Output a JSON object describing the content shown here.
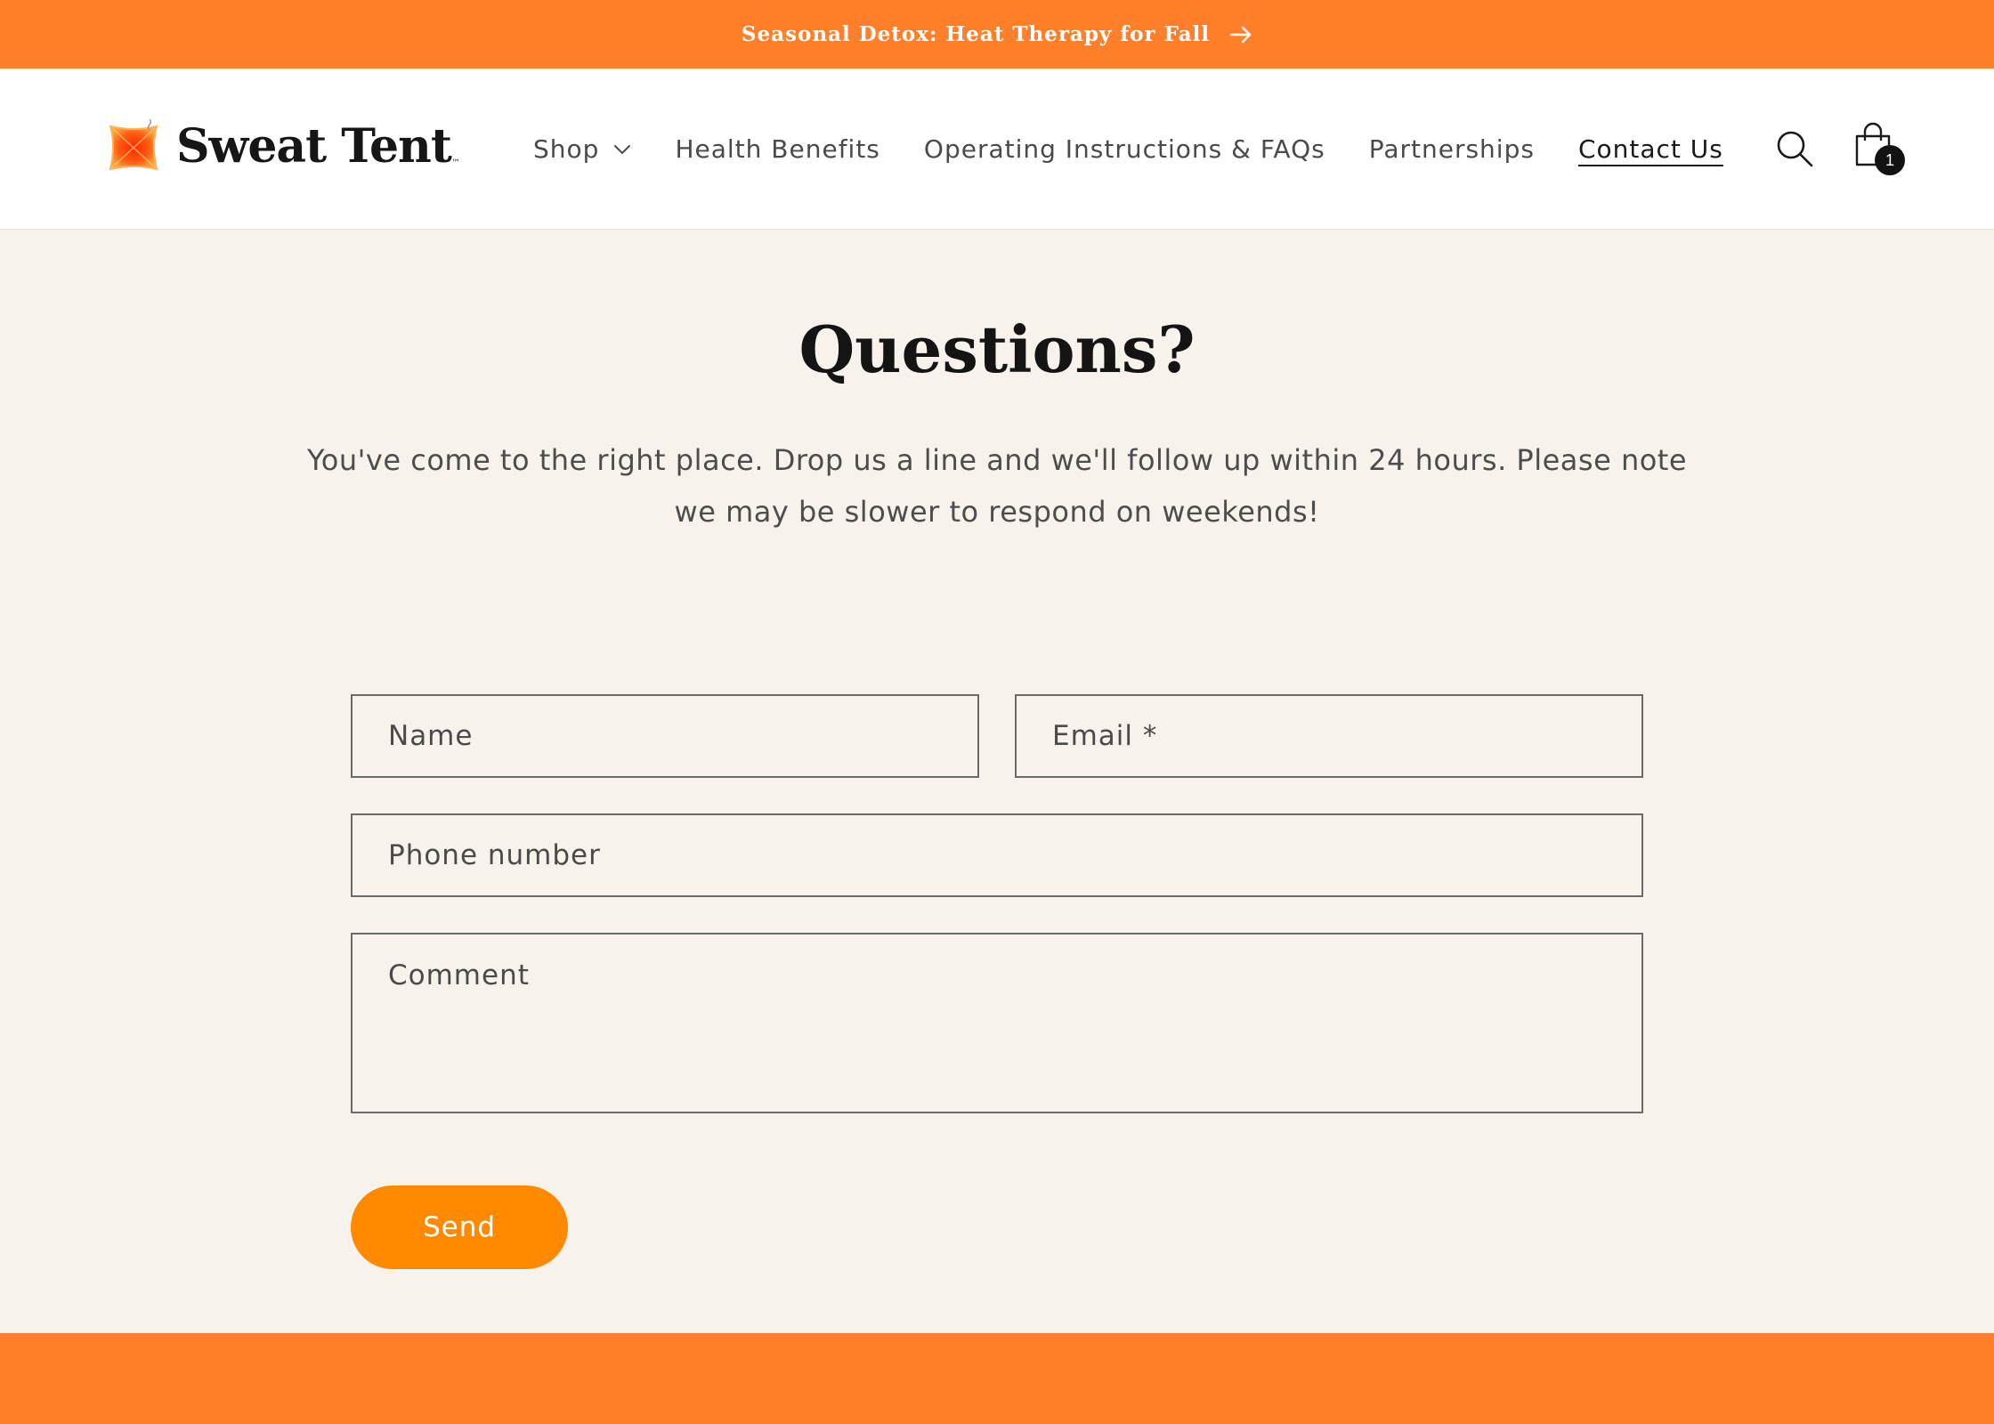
{
  "announcement": {
    "text": "Seasonal Detox: Heat Therapy for Fall",
    "icon": "arrow-right-icon"
  },
  "header": {
    "logo_text": "Sweat Tent",
    "logo_tm": "™",
    "nav": [
      {
        "label": "Shop",
        "has_dropdown": true
      },
      {
        "label": "Health Benefits"
      },
      {
        "label": "Operating Instructions & FAQs"
      },
      {
        "label": "Partnerships"
      },
      {
        "label": "Contact Us",
        "active": true
      }
    ],
    "search_icon": "search-icon",
    "cart_icon": "shopping-bag-icon",
    "cart_count": "1"
  },
  "main": {
    "title": "Questions?",
    "intro": "You've come to the right place. Drop us a line and we'll follow up within 24 hours. Please note we may be slower to respond on weekends!",
    "form": {
      "name_placeholder": "Name",
      "email_placeholder": "Email *",
      "phone_placeholder": "Phone number",
      "comment_placeholder": "Comment",
      "send_label": "Send"
    }
  },
  "colors": {
    "brand_orange": "#ff7f2a",
    "button_orange": "#ff8a00",
    "page_background": "#f8f2ec"
  }
}
